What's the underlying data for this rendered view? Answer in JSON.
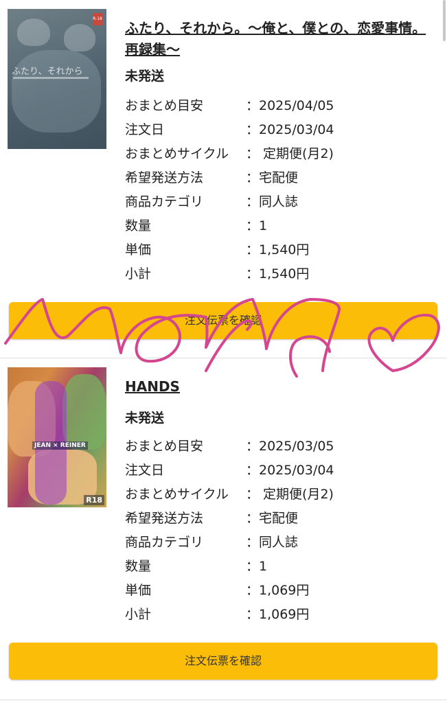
{
  "orders": [
    {
      "title": "ふたり、それから。〜俺と、僕との、恋愛事情。再録集〜",
      "status": "未発送",
      "cover": {
        "rating": "R-18",
        "text": "ふたり、それから"
      },
      "fields": [
        {
          "label": "おまとめ目安",
          "value": "：2025/04/05"
        },
        {
          "label": "注文日",
          "value": "：2025/03/04"
        },
        {
          "label": "おまとめサイクル",
          "value": "： 定期便(月2)"
        },
        {
          "label": "希望発送方法",
          "value": "：宅配便"
        },
        {
          "label": "商品カテゴリ",
          "value": "：同人誌"
        },
        {
          "label": "数量",
          "value": "：1"
        },
        {
          "label": "単価",
          "value": "：1,540円"
        },
        {
          "label": "小計",
          "value": "：1,540円"
        }
      ],
      "button_label": "注文伝票を確認"
    },
    {
      "title": "HANDS",
      "status": "未発送",
      "cover": {
        "tag": "JEAN × REINER",
        "rating": "R18"
      },
      "fields": [
        {
          "label": "おまとめ目安",
          "value": "：2025/03/05"
        },
        {
          "label": "注文日",
          "value": "：2025/03/04"
        },
        {
          "label": "おまとめサイクル",
          "value": "： 定期便(月2)"
        },
        {
          "label": "希望発送方法",
          "value": "：宅配便"
        },
        {
          "label": "商品カテゴリ",
          "value": "：同人誌"
        },
        {
          "label": "数量",
          "value": "：1"
        },
        {
          "label": "単価",
          "value": "：1,069円"
        },
        {
          "label": "小計",
          "value": "：1,069円"
        }
      ],
      "button_label": "注文伝票を確認"
    }
  ],
  "colors": {
    "button": "#fbbd08",
    "doodle": "#d4468f"
  }
}
